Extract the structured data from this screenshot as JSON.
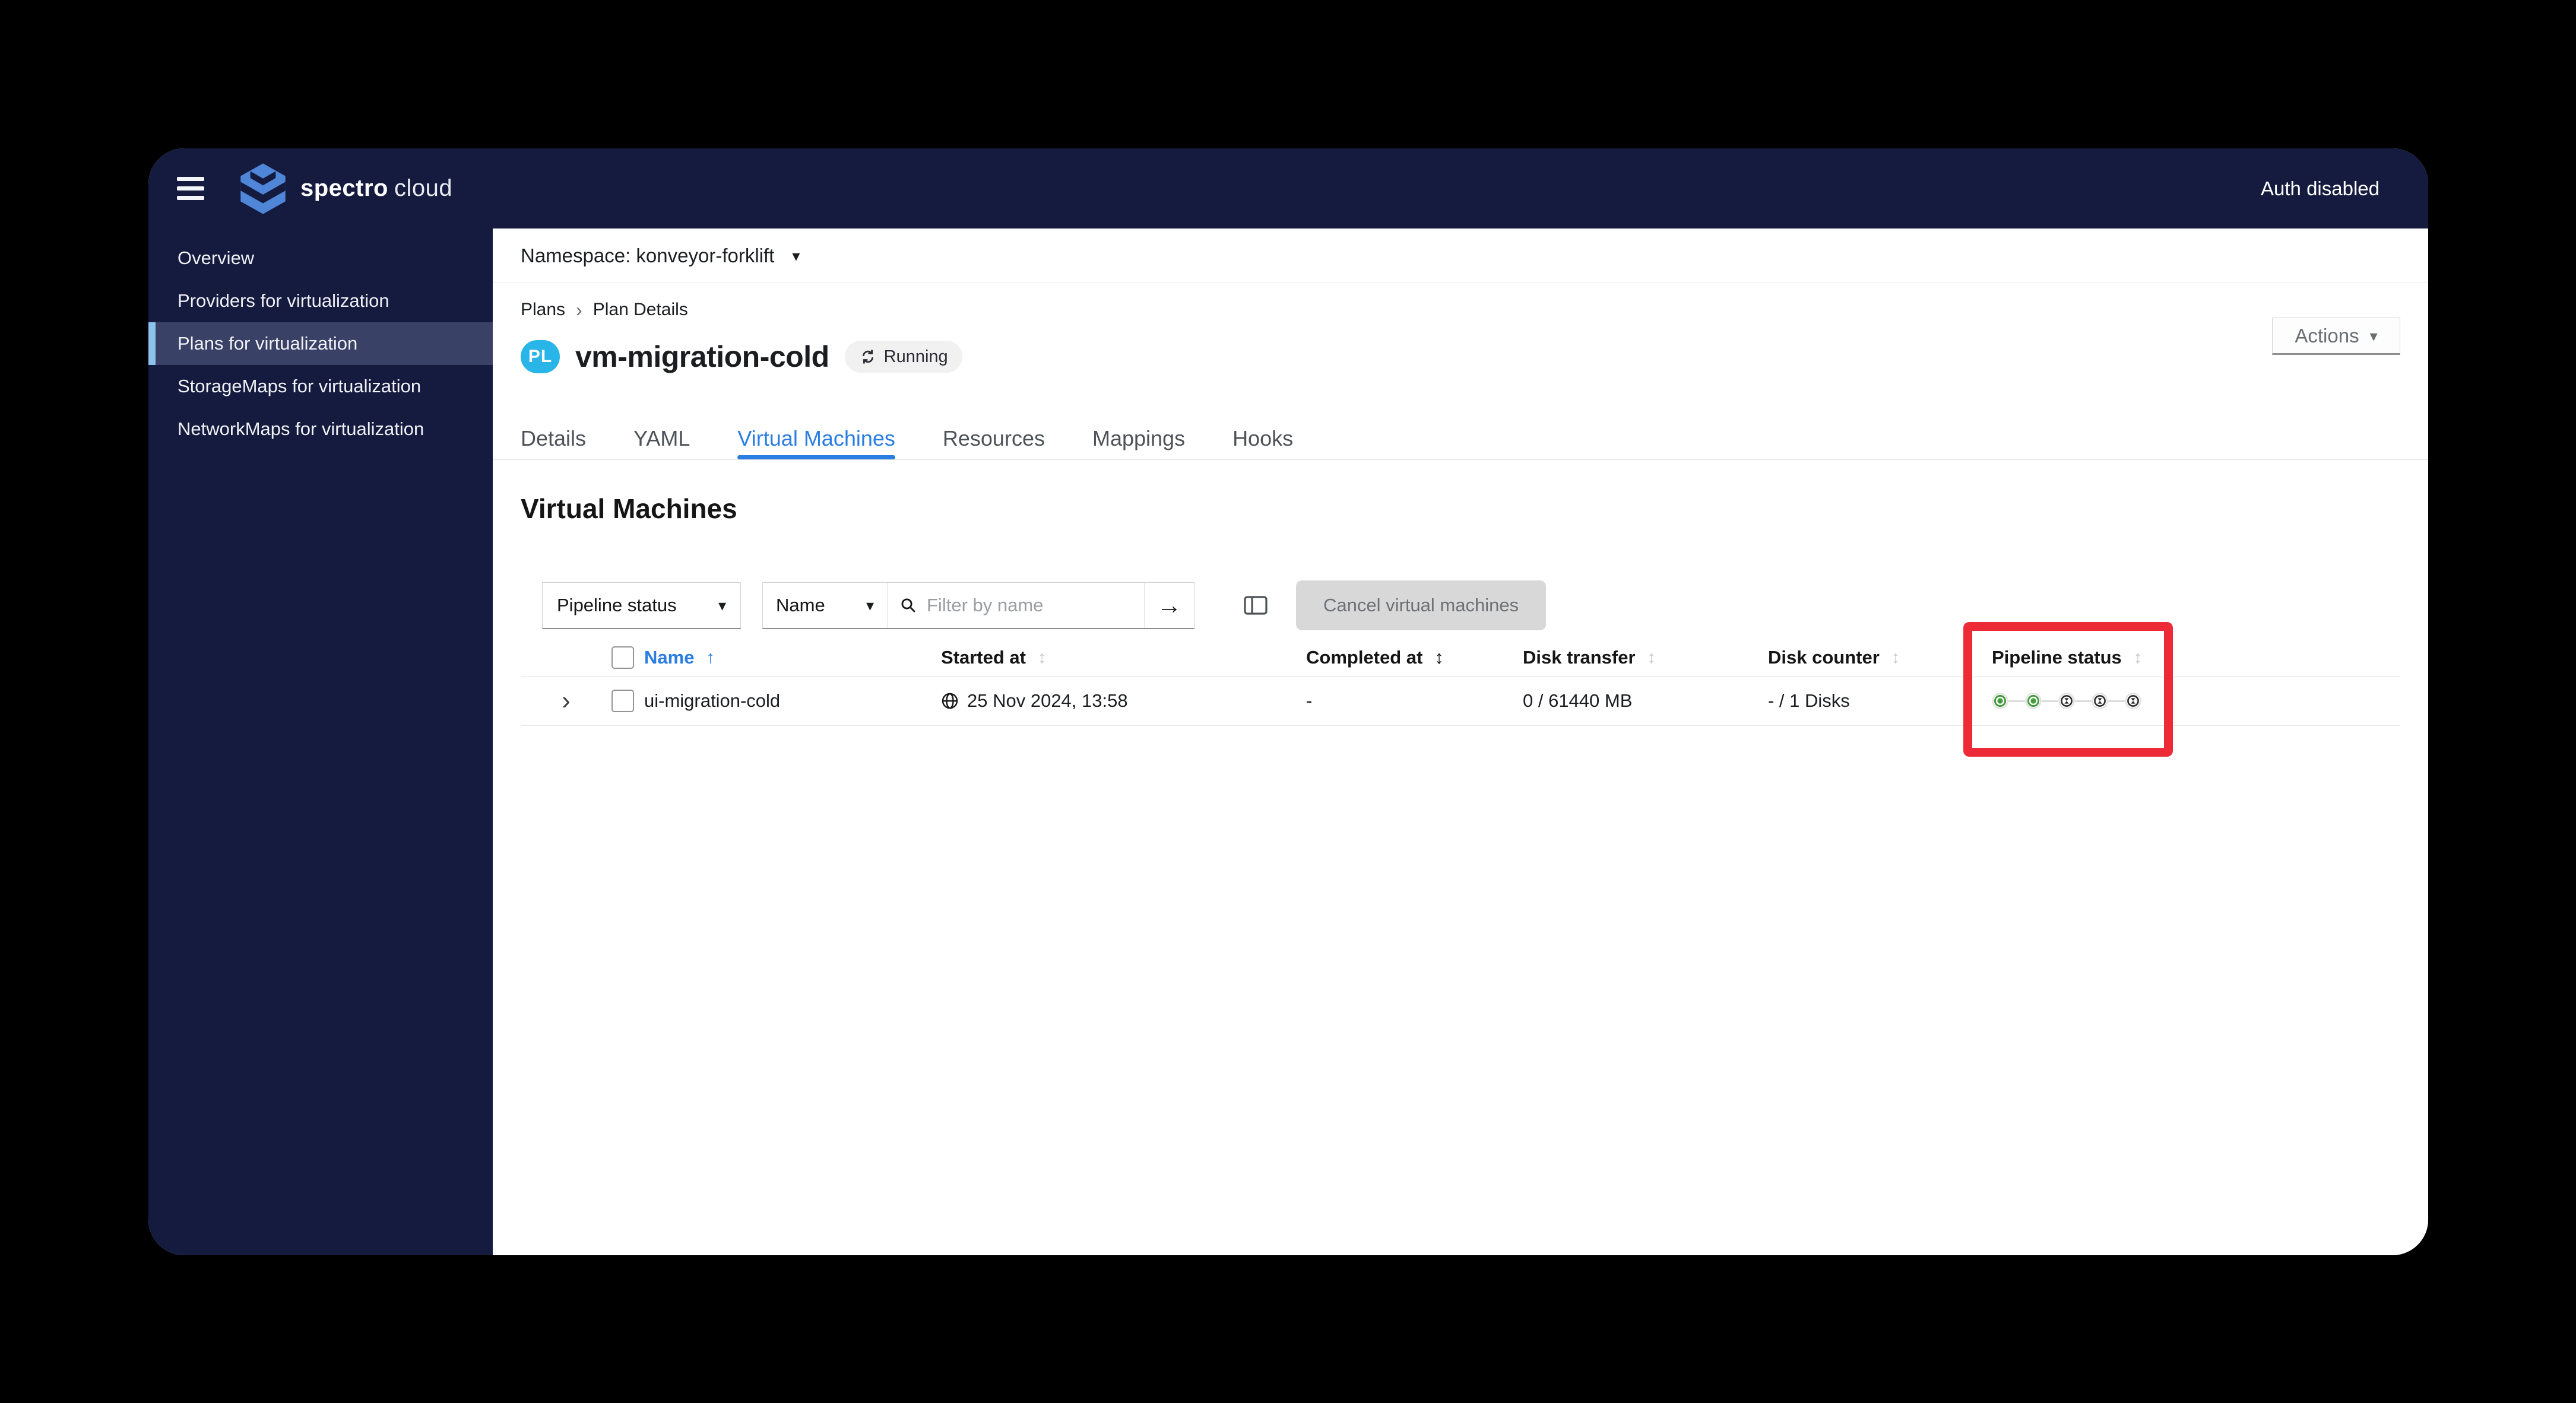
{
  "topbar": {
    "brand_primary": "spectro",
    "brand_secondary": "cloud",
    "auth_status": "Auth disabled"
  },
  "sidebar": {
    "items": [
      {
        "label": "Overview"
      },
      {
        "label": "Providers for virtualization"
      },
      {
        "label": "Plans for virtualization"
      },
      {
        "label": "StorageMaps for virtualization"
      },
      {
        "label": "NetworkMaps for virtualization"
      }
    ]
  },
  "namespace_bar": {
    "label": "Namespace: konveyor-forklift"
  },
  "breadcrumb": {
    "items": [
      {
        "label": "Plans"
      },
      {
        "label": "Plan Details"
      }
    ]
  },
  "plan": {
    "badge": "PL",
    "title": "vm-migration-cold",
    "status_label": "Running",
    "actions_label": "Actions"
  },
  "tabs": [
    {
      "label": "Details"
    },
    {
      "label": "YAML"
    },
    {
      "label": "Virtual Machines"
    },
    {
      "label": "Resources"
    },
    {
      "label": "Mappings"
    },
    {
      "label": "Hooks"
    }
  ],
  "vm_section": {
    "heading": "Virtual Machines",
    "toolbar": {
      "filter_category": "Pipeline status",
      "filter_field": "Name",
      "search_placeholder": "Filter by name",
      "cancel_button_label": "Cancel virtual machines"
    },
    "table": {
      "columns": [
        {
          "key": "name",
          "label": "Name",
          "sort": "asc"
        },
        {
          "key": "started_at",
          "label": "Started at",
          "sort": "both"
        },
        {
          "key": "completed_at",
          "label": "Completed at",
          "sort": "both-emph"
        },
        {
          "key": "disk_transfer",
          "label": "Disk transfer",
          "sort": "both"
        },
        {
          "key": "disk_counter",
          "label": "Disk counter",
          "sort": "both"
        },
        {
          "key": "pipeline_status",
          "label": "Pipeline status",
          "sort": "both"
        }
      ],
      "rows": [
        {
          "name": "ui-migration-cold",
          "started_at": "25 Nov 2024, 13:58",
          "completed_at": "-",
          "disk_transfer": "0 / 61440 MB",
          "disk_counter": "- / 1 Disks",
          "pipeline": [
            "complete",
            "complete",
            "pending",
            "pending",
            "pending"
          ]
        }
      ]
    }
  },
  "icons": {
    "sort_asc": "↑",
    "sort_both": "↕",
    "caret_down": "▾",
    "breadcrumb_sep": "›",
    "expander_chevron": "›",
    "arrow_right": "→"
  },
  "colors": {
    "navy": "#141b3e",
    "brand_cyan": "#29b5e8",
    "link_blue": "#2a7de1",
    "success_green": "#459c3e",
    "pending_dark": "#2b2b2b",
    "highlight_red": "#ec2b36"
  }
}
